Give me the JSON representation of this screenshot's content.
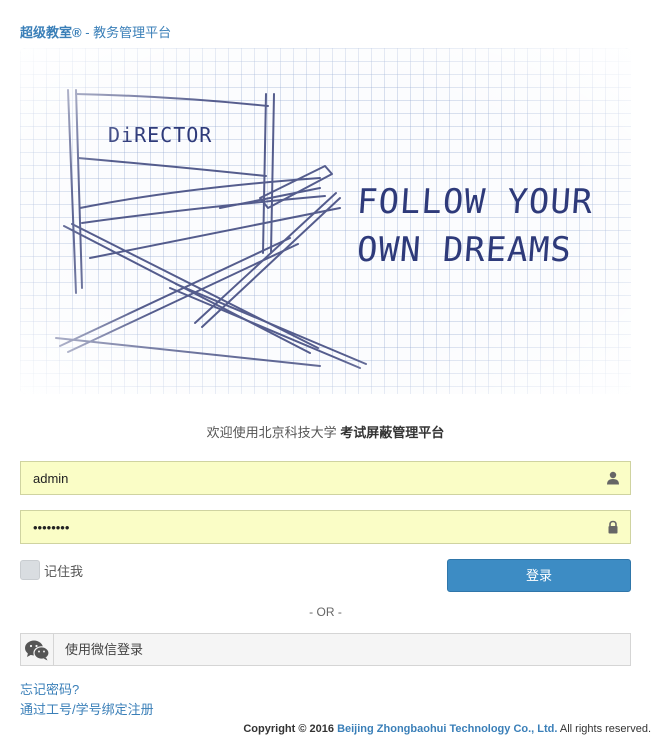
{
  "brand": {
    "name": "超级教室",
    "reg": "®",
    "separator": " - ",
    "subtitle": "教务管理平台"
  },
  "banner": {
    "chair_label": "DiRECTOR",
    "line1": "FOLLOW YOUR",
    "line2": "OWN DREAMS"
  },
  "welcome": {
    "prefix": "欢迎使用北京科技大学 ",
    "highlight": "考试屏蔽管理平台"
  },
  "form": {
    "username_value": "admin",
    "password_value": "••••••••",
    "remember_label": "记住我",
    "login_label": "登录"
  },
  "divider": "- OR -",
  "wechat": {
    "label": "使用微信登录"
  },
  "links": {
    "forgot": "忘记密码?",
    "bind": "通过工号/学号绑定注册"
  },
  "footer": {
    "copyright": "Copyright © 2016",
    "company": "Beijing Zhongbaohui Technology Co., Ltd.",
    "rights": "All rights reserved."
  },
  "colors": {
    "accent": "#3d8cc4",
    "link": "#3a7fb8",
    "input_bg": "#fafdc6"
  }
}
